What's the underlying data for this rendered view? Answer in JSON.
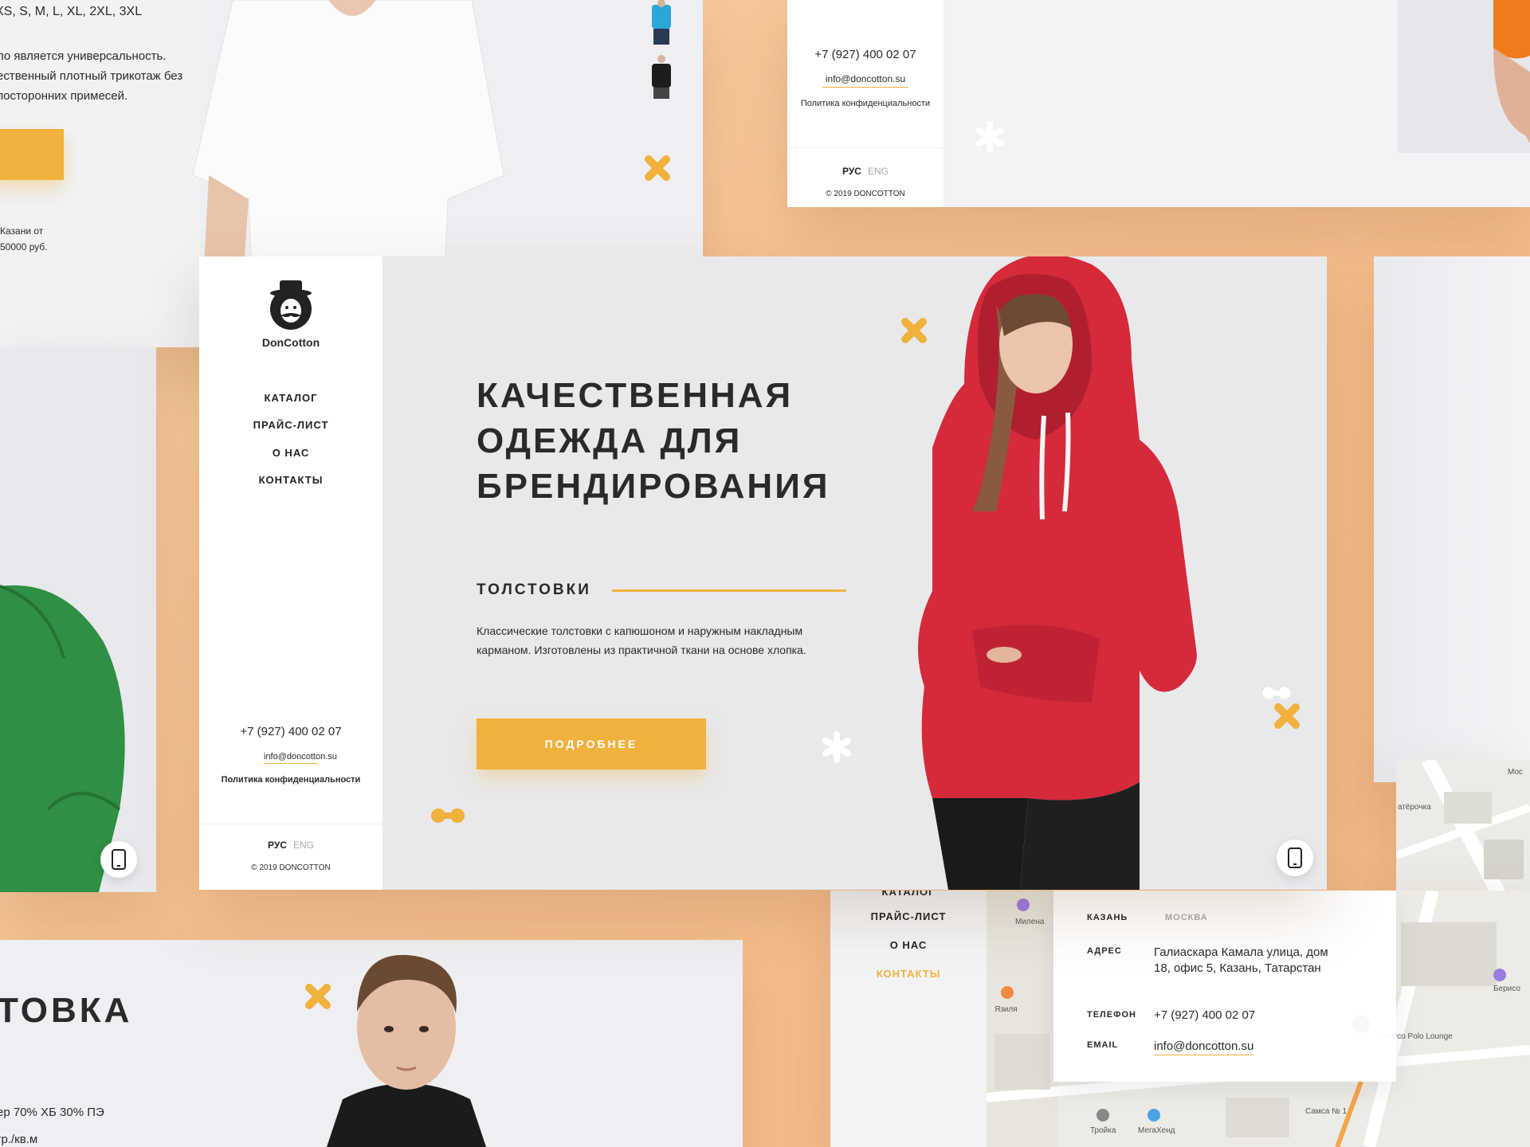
{
  "top_left": {
    "sizes": "XS, S, M, L, XL, 2XL, 3XL",
    "description": "ло является универсальность. ественный плотный трикотаж без посторонних примесей.",
    "note": "Казани от 50000 руб."
  },
  "top_right": {
    "phone": "+7 (927) 400 02 07",
    "email": "info@doncotton.su",
    "policy": "Политика конфиденциальности",
    "lang_active": "РУС",
    "lang_inactive": "ENG",
    "copyright": "© 2019 DONCOTTON"
  },
  "main": {
    "brand": "DonCotton",
    "nav": [
      "КАТАЛОГ",
      "ПРАЙС-ЛИСТ",
      "О НАС",
      "КОНТАКТЫ"
    ],
    "phone": "+7 (927) 400 02 07",
    "email": "info@doncotton.su",
    "policy": "Политика конфиденциальности",
    "lang_active": "РУС",
    "lang_inactive": "ENG",
    "copyright": "© 2019 DONCOTTON",
    "headline": "КАЧЕСТВЕННАЯ ОДЕЖДА ДЛЯ БРЕНДИРОВАНИЯ",
    "category": "ТОЛСТОВКИ",
    "description": "Классические толстовки с капюшоном и наружным накладным карманом. Изготовлены из практичной ткани на основе хлопка.",
    "cta": "ПОДРОБНЕЕ",
    "mobile_icon": "smartphone-icon"
  },
  "bottom_left": {
    "title": "ТОВКА",
    "spec1": "ер 70% ХБ 30% ПЭ",
    "spec2": "гр./кв.м"
  },
  "bottom_right": {
    "nav": [
      "КАТАЛОГ",
      "ПРАЙС-ЛИСТ",
      "О НАС",
      "КОНТАКТЫ"
    ],
    "city_active": "КАЗАНЬ",
    "city_inactive": "МОСКВА",
    "address_label": "АДРЕС",
    "address": "Галиаскара Камала улица, дом 18, офис 5, Казань, Татарстан",
    "phone_label": "ТЕЛЕФОН",
    "phone": "+7 (927) 400 02 07",
    "email_label": "EMAIL",
    "email": "info@doncotton.su",
    "map_labels": [
      "Милена",
      "Язиля",
      "МегаХенд",
      "Тройка",
      "Самса № 1",
      "Marco Polo Lounge",
      "Берисо",
      "атёрочка",
      "Moc"
    ]
  },
  "colors": {
    "accent": "#f0b13d",
    "background": "#f6c193",
    "hoodie": "#d42a3a"
  }
}
